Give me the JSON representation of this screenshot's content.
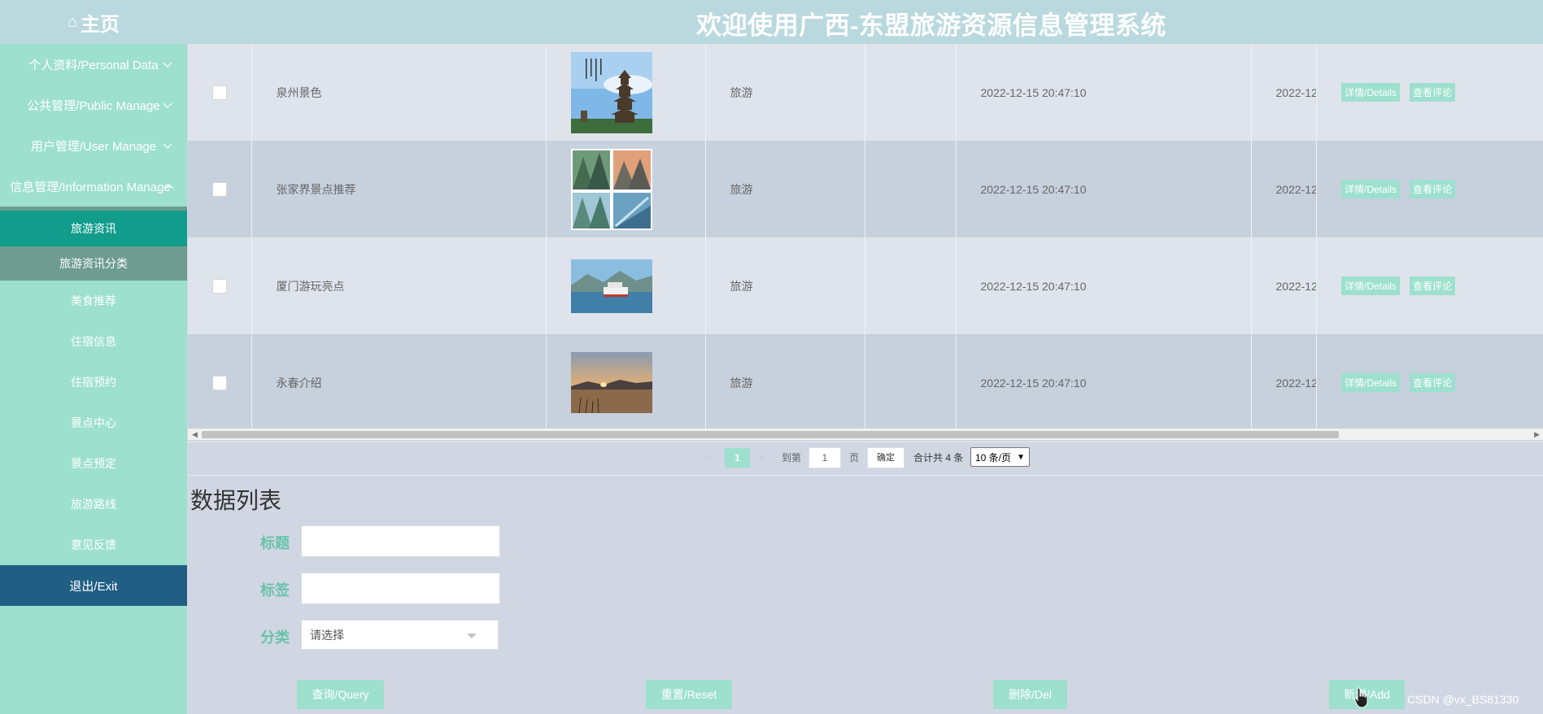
{
  "header": {
    "home_label": "主页",
    "home_icon": "home-icon",
    "title": "欢迎使用广西-东盟旅游资源信息管理系统"
  },
  "sidebar": {
    "menus": [
      {
        "label": "个人资料/Personal Data",
        "expanded": false
      },
      {
        "label": "公共管理/Public Manage",
        "expanded": false
      },
      {
        "label": "用户管理/User Manage",
        "expanded": false
      },
      {
        "label": "信息管理/Information Manage",
        "expanded": true
      }
    ],
    "subitems": [
      {
        "label": "旅游资讯",
        "state": "active"
      },
      {
        "label": "旅游资讯分类",
        "state": "hover"
      },
      {
        "label": "美食推荐"
      },
      {
        "label": "住宿信息"
      },
      {
        "label": "住宿预约"
      },
      {
        "label": "景点中心"
      },
      {
        "label": "景点预定"
      },
      {
        "label": "旅游路线"
      },
      {
        "label": "意见反馈"
      }
    ],
    "exit_label": "退出/Exit"
  },
  "table": {
    "rows": [
      {
        "title": "泉州景色",
        "image": "pagoda-photo",
        "tag": "旅游",
        "category": "",
        "time": "2022-12-15 20:47:10",
        "time2": "2022-12"
      },
      {
        "title": "张家界景点推荐",
        "image": "mountain-collage-photo",
        "tag": "旅游",
        "category": "",
        "time": "2022-12-15 20:47:10",
        "time2": "2022-12"
      },
      {
        "title": "厦门游玩亮点",
        "image": "ferry-photo",
        "tag": "旅游",
        "category": "",
        "time": "2022-12-15 20:47:10",
        "time2": "2022-12"
      },
      {
        "title": "永春介绍",
        "image": "sunset-lake-photo",
        "tag": "旅游",
        "category": "",
        "time": "2022-12-15 20:47:10",
        "time2": "2022-12"
      }
    ],
    "details_label": "详情/Details",
    "comments_label": "查看评论"
  },
  "pagination": {
    "prev": "‹",
    "current_page": "1",
    "next": "›",
    "goto_label": "到第",
    "goto_value": "1",
    "page_label": "页",
    "confirm_label": "确定",
    "total_label": "合计共 4 条",
    "page_size": "10 条/页"
  },
  "search": {
    "section_title": "数据列表",
    "fields": {
      "title_label": "标题",
      "tag_label": "标签",
      "category_label": "分类",
      "category_placeholder": "请选择"
    },
    "buttons": {
      "query": "查询/Query",
      "reset": "重置/Reset",
      "delete": "删除/Del",
      "add": "新增/Add"
    }
  },
  "watermark": "CSDN @vx_BS81330",
  "colors": {
    "accent": "#9de0cd",
    "active": "#119c8b",
    "exit": "#215e84",
    "header": "#b9d9df"
  }
}
